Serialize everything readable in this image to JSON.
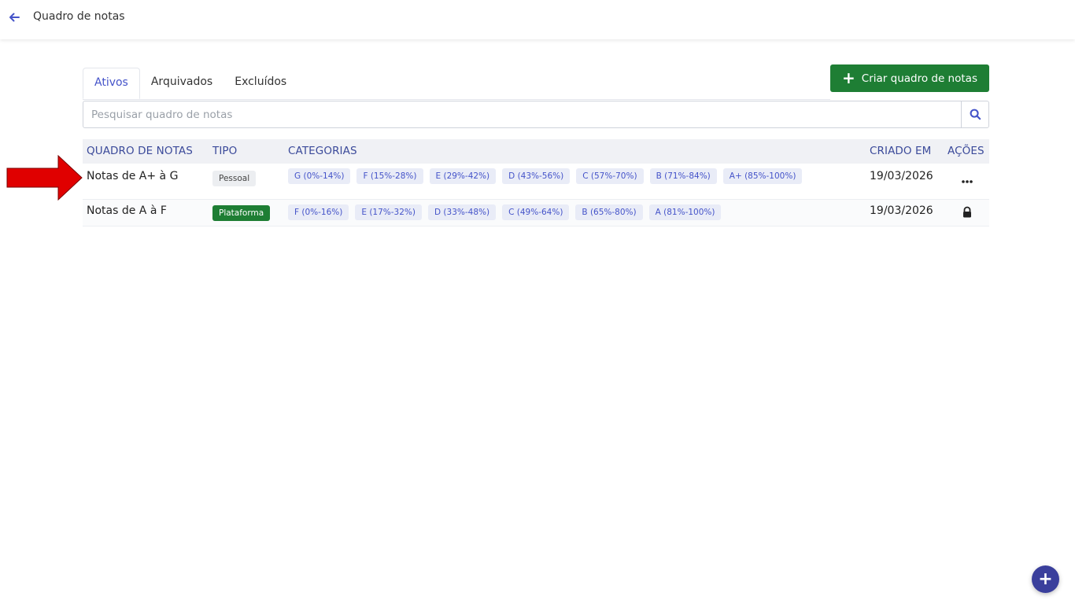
{
  "header": {
    "title": "Quadro de notas",
    "back_icon": "arrow-left-icon"
  },
  "tabs": [
    {
      "label": "Ativos",
      "active": true
    },
    {
      "label": "Arquivados",
      "active": false
    },
    {
      "label": "Excluídos",
      "active": false
    }
  ],
  "create_button": {
    "label": "Criar quadro de notas",
    "icon": "plus-icon"
  },
  "search": {
    "placeholder": "Pesquisar quadro de notas",
    "value": "",
    "icon": "search-icon"
  },
  "table": {
    "headers": {
      "name": "QUADRO DE NOTAS",
      "type": "TIPO",
      "categories": "CATEGORIAS",
      "created": "CRIADO EM",
      "actions": "AÇÕES"
    },
    "rows": [
      {
        "name": "Notas de A+ à G",
        "type": "Pessoal",
        "categories": [
          "G (0%-14%)",
          "F (15%-28%)",
          "E (29%-42%)",
          "D (43%-56%)",
          "C (57%-70%)",
          "B (71%-84%)",
          "A+ (85%-100%)"
        ],
        "created": "19/03/2026",
        "action_icon": "more-horizontal-icon"
      },
      {
        "name": "Notas de A à F",
        "type": "Plataforma",
        "categories": [
          "F (0%-16%)",
          "E (17%-32%)",
          "D (33%-48%)",
          "C (49%-64%)",
          "B (65%-80%)",
          "A (81%-100%)"
        ],
        "created": "19/03/2026",
        "action_icon": "lock-icon"
      }
    ]
  },
  "colors": {
    "primary": "#4453c9",
    "success": "#1e7e34",
    "annotation_arrow": "#e00000",
    "fab": "#3a3f9c"
  },
  "fab": {
    "label": "+"
  }
}
